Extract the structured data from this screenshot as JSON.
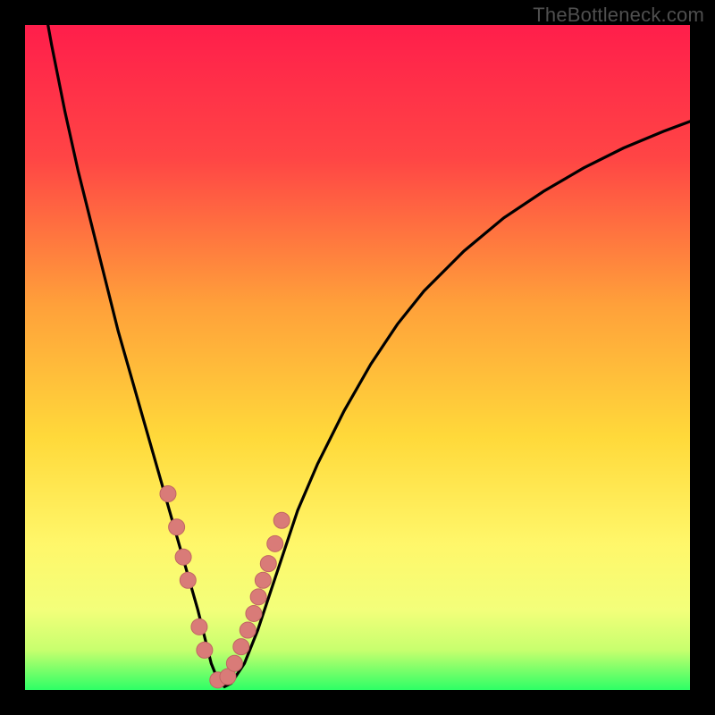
{
  "watermark": "TheBottleneck.com",
  "colors": {
    "black": "#000000",
    "curve": "#000000",
    "marker_fill": "#d97b78",
    "marker_stroke": "#c06663",
    "grad_top": "#ff1e4b",
    "grad_mid1": "#ff7a3a",
    "grad_mid2": "#ffd43a",
    "grad_mid3": "#fff97a",
    "grad_bottom": "#2dff66"
  },
  "chart_data": {
    "type": "line",
    "title": "",
    "xlabel": "",
    "ylabel": "",
    "xlim": [
      0,
      100
    ],
    "ylim": [
      0,
      100
    ],
    "series": [
      {
        "name": "bottleneck-curve",
        "x": [
          0,
          2,
          4,
          6,
          8,
          10,
          12,
          14,
          16,
          18,
          20,
          22,
          24,
          26,
          27,
          28,
          29,
          30,
          31,
          33,
          35,
          37,
          39,
          41,
          44,
          48,
          52,
          56,
          60,
          66,
          72,
          78,
          84,
          90,
          96,
          100
        ],
        "values": [
          120,
          108,
          97,
          87,
          78,
          70,
          62,
          54,
          47,
          40,
          33,
          26,
          19,
          12,
          8,
          4,
          1.5,
          0.5,
          1,
          4,
          9,
          15,
          21,
          27,
          34,
          42,
          49,
          55,
          60,
          66,
          71,
          75,
          78.5,
          81.5,
          84,
          85.5
        ]
      }
    ],
    "markers": {
      "name": "notable-points",
      "x": [
        21.5,
        22.8,
        23.8,
        24.5,
        26.2,
        27.0,
        29.0,
        30.5,
        31.5,
        32.5,
        33.5,
        34.4,
        35.1,
        35.8,
        36.6,
        37.6,
        38.6
      ],
      "values": [
        29.5,
        24.5,
        20.0,
        16.5,
        9.5,
        6.0,
        1.5,
        2.0,
        4.0,
        6.5,
        9.0,
        11.5,
        14.0,
        16.5,
        19.0,
        22.0,
        25.5
      ]
    },
    "legend": null
  }
}
